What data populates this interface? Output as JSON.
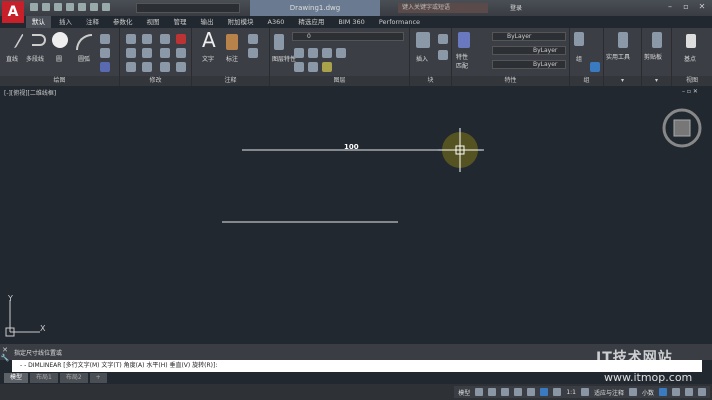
{
  "app": {
    "title": "Drawing1.dwg",
    "logo": "A",
    "search_placeholder": "键入关键字或短语",
    "user": "登录"
  },
  "tabs": [
    "默认",
    "插入",
    "注释",
    "参数化",
    "视图",
    "管理",
    "输出",
    "附加模块",
    "A360",
    "精选应用",
    "BIM 360",
    "Performance"
  ],
  "ribbon": {
    "draw": {
      "title": "绘图",
      "items": [
        "直线",
        "多段线",
        "圆",
        "圆弧"
      ]
    },
    "modify": {
      "title": "修改"
    },
    "annotation": {
      "title": "注释",
      "items": [
        "文字",
        "标注"
      ]
    },
    "layers": {
      "title": "图层",
      "items": [
        "图层特性"
      ]
    },
    "block": {
      "title": "块",
      "items": [
        "插入"
      ]
    },
    "properties": {
      "title": "特性",
      "items": [
        "特性匹配"
      ],
      "color": "ByLayer",
      "linetype": "ByLayer",
      "lineweight": "ByLayer"
    },
    "groups": {
      "title": "组",
      "items": [
        "组"
      ]
    },
    "utilities": {
      "title": "",
      "items": [
        "实用工具"
      ]
    },
    "clipboard": {
      "title": "",
      "items": [
        "剪贴板"
      ]
    },
    "view": {
      "title": "视图",
      "items": [
        "基点"
      ]
    }
  },
  "viewport": {
    "label": "[-][俯视][二维线框]",
    "dimension": "100",
    "ucs_x": "X",
    "ucs_y": "Y"
  },
  "command": {
    "history": "指定尺寸线位置或",
    "prompt": "DIMLINEAR [多行文字(M) 文字(T) 角度(A) 水平(H) 垂直(V) 旋转(R)]:",
    "prefix": "- -"
  },
  "layout_tabs": [
    "模型",
    "布局1",
    "布局2",
    "+"
  ],
  "status": {
    "model": "模型",
    "scale": "1:1",
    "annotate": "适应与注释",
    "units": "小数"
  },
  "watermark": {
    "line1": "IT技术网站",
    "line2": "www.itmop.com"
  }
}
